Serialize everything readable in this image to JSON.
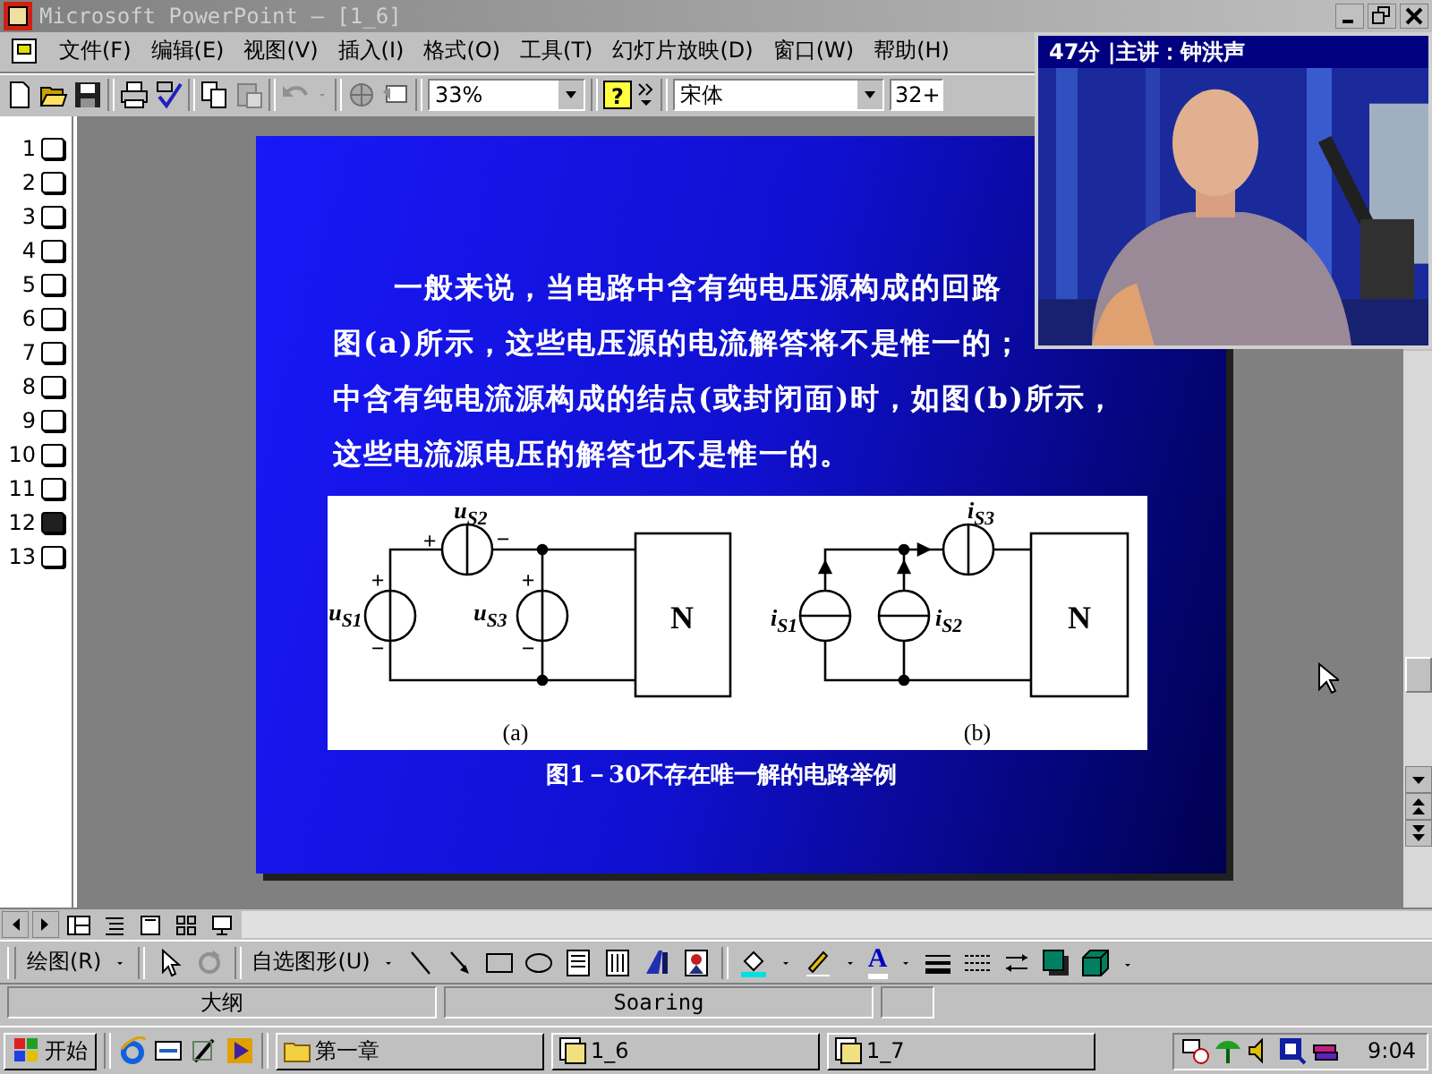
{
  "window": {
    "title": "Microsoft PowerPoint — [1_6]"
  },
  "menu": [
    "文件(F)",
    "编辑(E)",
    "视图(V)",
    "插入(I)",
    "格式(O)",
    "工具(T)",
    "幻灯片放映(D)",
    "窗口(W)",
    "帮助(H)"
  ],
  "toolbar": {
    "zoom": "33%",
    "help_glyph": "?",
    "font": "宋体",
    "font_size": "32+"
  },
  "outline": [
    {
      "number": "1",
      "selected": false
    },
    {
      "number": "2",
      "selected": false
    },
    {
      "number": "3",
      "selected": false
    },
    {
      "number": "4",
      "selected": false
    },
    {
      "number": "5",
      "selected": false
    },
    {
      "number": "6",
      "selected": false
    },
    {
      "number": "7",
      "selected": false
    },
    {
      "number": "8",
      "selected": false
    },
    {
      "number": "9",
      "selected": false
    },
    {
      "number": "10",
      "selected": false
    },
    {
      "number": "11",
      "selected": false
    },
    {
      "number": "12",
      "selected": true
    },
    {
      "number": "13",
      "selected": false
    }
  ],
  "slide": {
    "paragraph_lines": [
      "一般来说，当电路中含有纯电压源构成的回路",
      "图(a)所示，这些电压源的电流解答将不是惟一的；",
      "中含有纯电流源构成的结点(或封闭面)时，如图(b)所示，",
      "这些电流源电压的解答也不是惟一的。"
    ],
    "circuit_a": {
      "labels": [
        "u$_{S2}$",
        "+",
        "−",
        "+",
        "u$_{S1}$",
        "−",
        "+",
        "u$_{S3}$",
        "−",
        "N"
      ],
      "caption": "(a)"
    },
    "circuit_b": {
      "labels": [
        "i$_{S3}$",
        "i$_{S1}$",
        "i$_{S2}$",
        "N"
      ],
      "caption": "(b)"
    },
    "caption": "图1－30不存在唯一解的电路举例"
  },
  "video": {
    "title": "47分 |主讲：钟洪声"
  },
  "drawing_toolbar": {
    "draw_menu": "绘图(R)",
    "autoshapes_menu": "自选图形(U)",
    "font_color_glyph": "A"
  },
  "status_bar": {
    "view": "大纲",
    "design": "Soaring"
  },
  "taskbar": {
    "start": "开始",
    "tasks": [
      "第一章",
      "1_6",
      "1_7"
    ],
    "clock": "9:04"
  }
}
